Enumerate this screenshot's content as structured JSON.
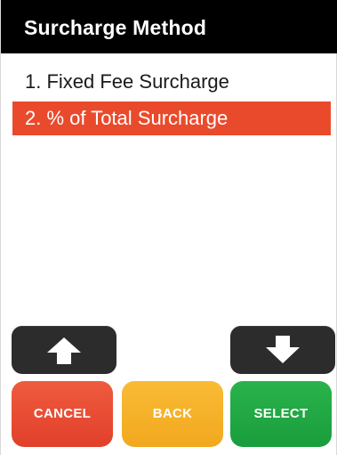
{
  "header": {
    "title": "Surcharge Method"
  },
  "menu": {
    "items": [
      {
        "label": "1. Fixed Fee Surcharge",
        "selected": false
      },
      {
        "label": "2. % of Total Surcharge",
        "selected": true
      }
    ],
    "highlight_color": "#ea4a2c"
  },
  "nav": {
    "up_icon": "arrow-up-icon",
    "down_icon": "arrow-down-icon"
  },
  "actions": {
    "cancel_label": "CANCEL",
    "back_label": "BACK",
    "select_label": "SELECT",
    "cancel_color": "#e8482f",
    "back_color": "#f5b02a",
    "select_color": "#22a845"
  }
}
